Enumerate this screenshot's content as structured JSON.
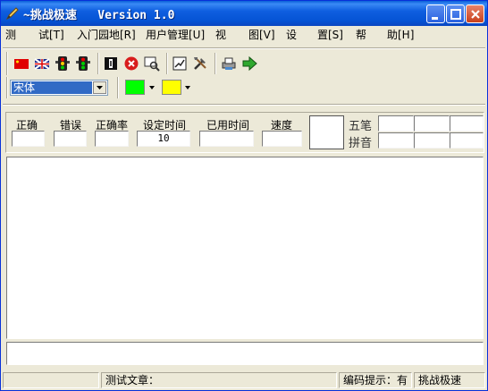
{
  "window": {
    "title": "~挑战极速   Version 1.0"
  },
  "menu": [
    {
      "label": "测"
    },
    {
      "label": "试[T]"
    },
    {
      "label": "入门园地[R]"
    },
    {
      "label": "用户管理[U]"
    },
    {
      "label": "视"
    },
    {
      "label": "图[V]"
    },
    {
      "label": "设"
    },
    {
      "label": "置[S]"
    },
    {
      "label": "帮"
    },
    {
      "label": "助[H]"
    }
  ],
  "toolbar": {
    "icons": [
      "china-flag-icon",
      "uk-flag-icon",
      "traffic-light-icon",
      "traffic-light-green-icon",
      "exit-door-icon",
      "stop-icon",
      "search-icon",
      "chart-icon",
      "tools-icon",
      "print-icon",
      "go-arrow-icon"
    ],
    "font_value": "宋体",
    "text_color": "#00ff00",
    "bg_color": "#ffff00"
  },
  "stats": {
    "correct_label": "正确",
    "errors_label": "错误",
    "accuracy_label": "正确率",
    "set_time_label": "设定时间",
    "set_time_value": "10",
    "elapsed_label": "已用时间",
    "speed_label": "速度",
    "correct_value": "",
    "errors_value": "",
    "accuracy_value": "",
    "elapsed_value": "",
    "speed_value": ""
  },
  "codes": {
    "wubi_label": "五笔",
    "pinyin_label": "拼音"
  },
  "statusbar": {
    "article_label": "测试文章：",
    "hint_label": "编码提示：有",
    "mode_label": "挑战极速"
  }
}
